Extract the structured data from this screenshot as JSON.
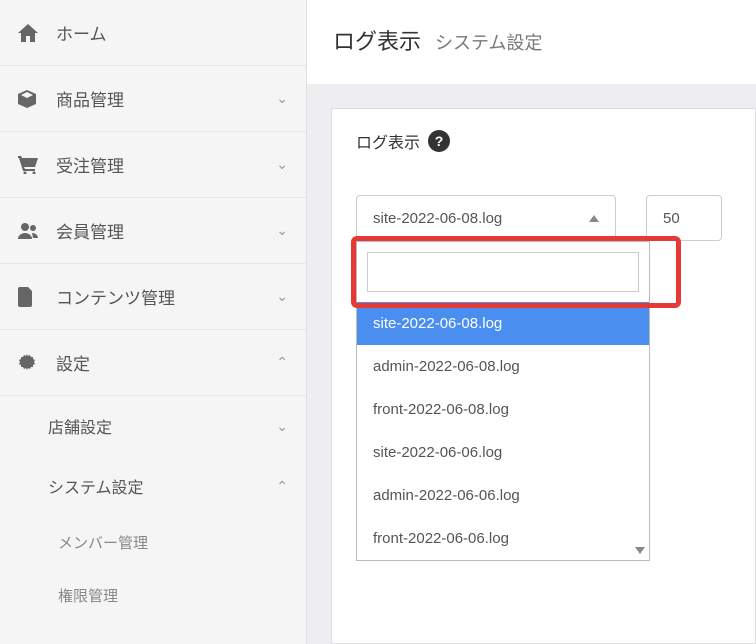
{
  "sidebar": {
    "items": [
      {
        "icon": "home",
        "label": "ホーム",
        "chevron": null
      },
      {
        "icon": "cube",
        "label": "商品管理",
        "chevron": "down"
      },
      {
        "icon": "cart",
        "label": "受注管理",
        "chevron": "down"
      },
      {
        "icon": "users",
        "label": "会員管理",
        "chevron": "down"
      },
      {
        "icon": "file",
        "label": "コンテンツ管理",
        "chevron": "down"
      },
      {
        "icon": "gear",
        "label": "設定",
        "chevron": "up"
      }
    ],
    "settings_sub": [
      {
        "label": "店舗設定",
        "chevron": "down"
      },
      {
        "label": "システム設定",
        "chevron": "up"
      }
    ],
    "system_sub": [
      {
        "label": "メンバー管理"
      },
      {
        "label": "権限管理"
      }
    ]
  },
  "header": {
    "title": "ログ表示",
    "subtitle": "システム設定"
  },
  "card": {
    "title": "ログ表示"
  },
  "controls": {
    "selected_log": "site-2022-06-08.log",
    "count": "50",
    "search": ""
  },
  "dropdown": {
    "options": [
      "site-2022-06-08.log",
      "admin-2022-06-08.log",
      "front-2022-06-08.log",
      "site-2022-06-06.log",
      "admin-2022-06-06.log",
      "front-2022-06-06.log"
    ],
    "selected_index": 0
  }
}
